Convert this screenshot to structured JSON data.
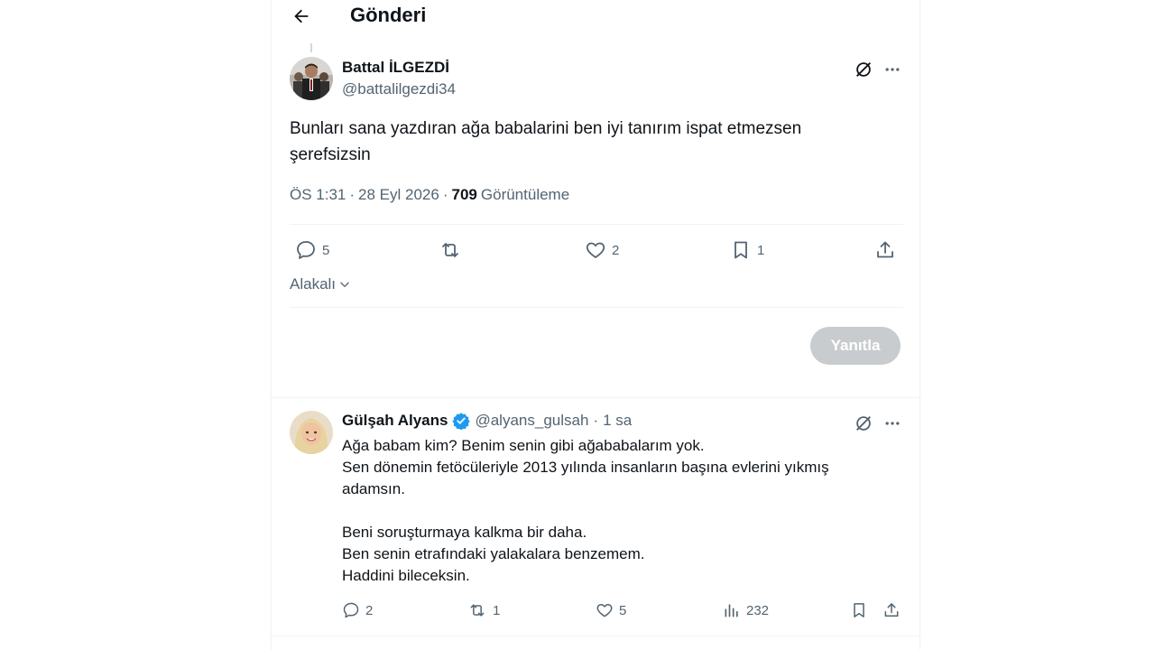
{
  "header": {
    "title": "Gönderi"
  },
  "post": {
    "author_name": "Battal İLGEZDİ",
    "author_handle": "@battalilgezdi34",
    "text": "Bunları sana yazdıran ağa babalarini ben iyi tanırım ispat etmezsen şerefsizsin",
    "time": "ÖS 1:31",
    "date": "28 Eyl 2026",
    "views_count": "709",
    "views_label": "Görüntüleme",
    "actions": {
      "replies": "5",
      "retweets": "",
      "likes": "2",
      "bookmarks": "1"
    }
  },
  "sort": {
    "label": "Alakalı"
  },
  "composer": {
    "reply_button": "Yanıtla"
  },
  "reply": {
    "author_name": "Gülşah Alyans",
    "author_handle": "@alyans_gulsah",
    "time": "1 sa",
    "verified": true,
    "lines": [
      "Ağa babam kim? Benim senin gibi ağababalarım yok.",
      "Sen dönemin fetöcüleriyle 2013 yılında insanların başına evlerini yıkmış adamsın.",
      "",
      "Beni soruşturmaya kalkma bir daha.",
      "Ben senin etrafındaki yalakalara benzemem.",
      "Haddini bileceksin."
    ],
    "actions": {
      "replies": "2",
      "retweets": "1",
      "likes": "5",
      "views": "232"
    }
  },
  "colors": {
    "text": "#0f1419",
    "secondary": "#536471",
    "verified": "#1d9bf0",
    "border": "#eff3f4",
    "button_disabled": "#c9ccce"
  },
  "icons": [
    "back-arrow-icon",
    "grok-icon",
    "more-icon",
    "reply-icon",
    "retweet-icon",
    "like-icon",
    "bookmark-icon",
    "share-icon",
    "views-icon",
    "chevron-down-icon",
    "verified-badge-icon"
  ]
}
